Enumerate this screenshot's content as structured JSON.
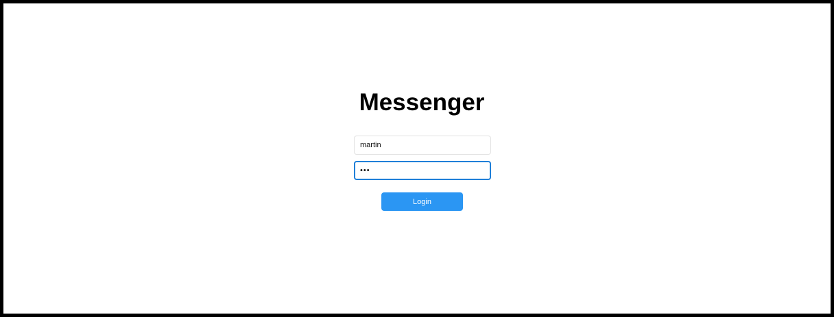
{
  "app": {
    "title": "Messenger"
  },
  "login_form": {
    "username_value": "martin",
    "password_value": "•••",
    "login_label": "Login"
  },
  "colors": {
    "accent": "#2b96f3",
    "focus_border": "#1f7fd8",
    "frame_border": "#000000",
    "background": "#ffffff"
  }
}
